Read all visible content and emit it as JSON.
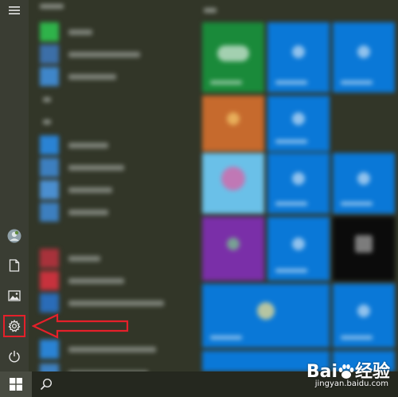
{
  "start_menu": {
    "rail": {
      "hamburger_icon": "hamburger-icon",
      "user_icon": "avatar",
      "documents_icon": "document-icon",
      "pictures_icon": "picture-icon",
      "settings_icon": "gear-icon",
      "power_icon": "power-icon"
    },
    "highlight_color": "#e5202a",
    "tile_blue": "#0a78d7"
  },
  "taskbar": {
    "start_icon": "windows-logo-icon",
    "search_icon": "search-icon"
  },
  "watermark": {
    "logo_prefix": "Bai",
    "logo_suffix": "经验",
    "url": "jingyan.baidu.com"
  }
}
